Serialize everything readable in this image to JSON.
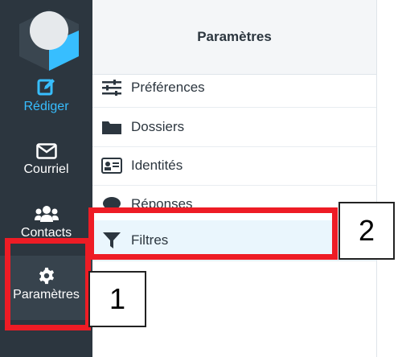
{
  "sidebar": {
    "items": [
      {
        "label": "Rédiger",
        "icon": "compose-icon"
      },
      {
        "label": "Courriel",
        "icon": "envelope-icon"
      },
      {
        "label": "Contacts",
        "icon": "users-icon"
      },
      {
        "label": "Paramètres",
        "icon": "gear-icon"
      }
    ]
  },
  "panel": {
    "title": "Paramètres",
    "items": [
      {
        "label": "Préférences",
        "icon": "sliders-icon"
      },
      {
        "label": "Dossiers",
        "icon": "folder-icon"
      },
      {
        "label": "Identités",
        "icon": "id-card-icon"
      },
      {
        "label": "Réponses",
        "icon": "comment-icon"
      },
      {
        "label": "Filtres",
        "icon": "filter-icon"
      }
    ]
  },
  "callouts": {
    "one": "1",
    "two": "2"
  },
  "colors": {
    "sidebar_bg": "#2c363f",
    "accent": "#37beff",
    "highlight": "#ee1c25"
  }
}
